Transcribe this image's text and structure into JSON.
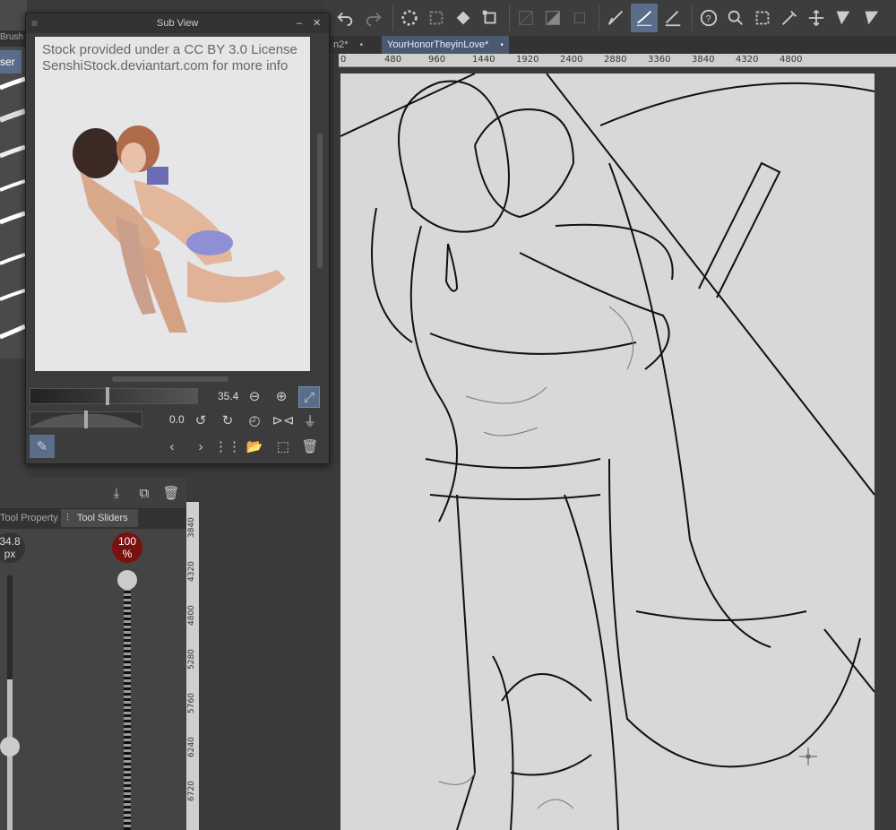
{
  "subview": {
    "title": "Sub View",
    "photo_text_line1": "Stock provided under a CC BY 3.0 License",
    "photo_text_line2": "SenshiStock.deviantart.com for more info",
    "zoom_value": "35.4",
    "rotate_value": "0.0"
  },
  "tabs": [
    {
      "label": "n2*"
    },
    {
      "label": "YourHonorTheyinLove*"
    }
  ],
  "brush_panel": {
    "tab_label": "Brush",
    "item_label": "ser"
  },
  "tool_panel": {
    "tab_property": "Tool Property",
    "tab_sliders": "Tool Sliders",
    "size_value": "34.8",
    "size_unit": "px",
    "opacity_value": "100",
    "opacity_unit": "%"
  },
  "hruler_labels": [
    "0",
    "480",
    "960",
    "1440",
    "1920",
    "2400",
    "2880",
    "3360",
    "3840",
    "4320",
    "4800"
  ],
  "vruler_labels": [
    "3840",
    "4320",
    "4800",
    "5280",
    "5760",
    "6240",
    "6720"
  ],
  "colors": {
    "accent": "#5a6e8c",
    "opacity_bubble": "#7a1010",
    "canvas": "#d8d8d8"
  }
}
